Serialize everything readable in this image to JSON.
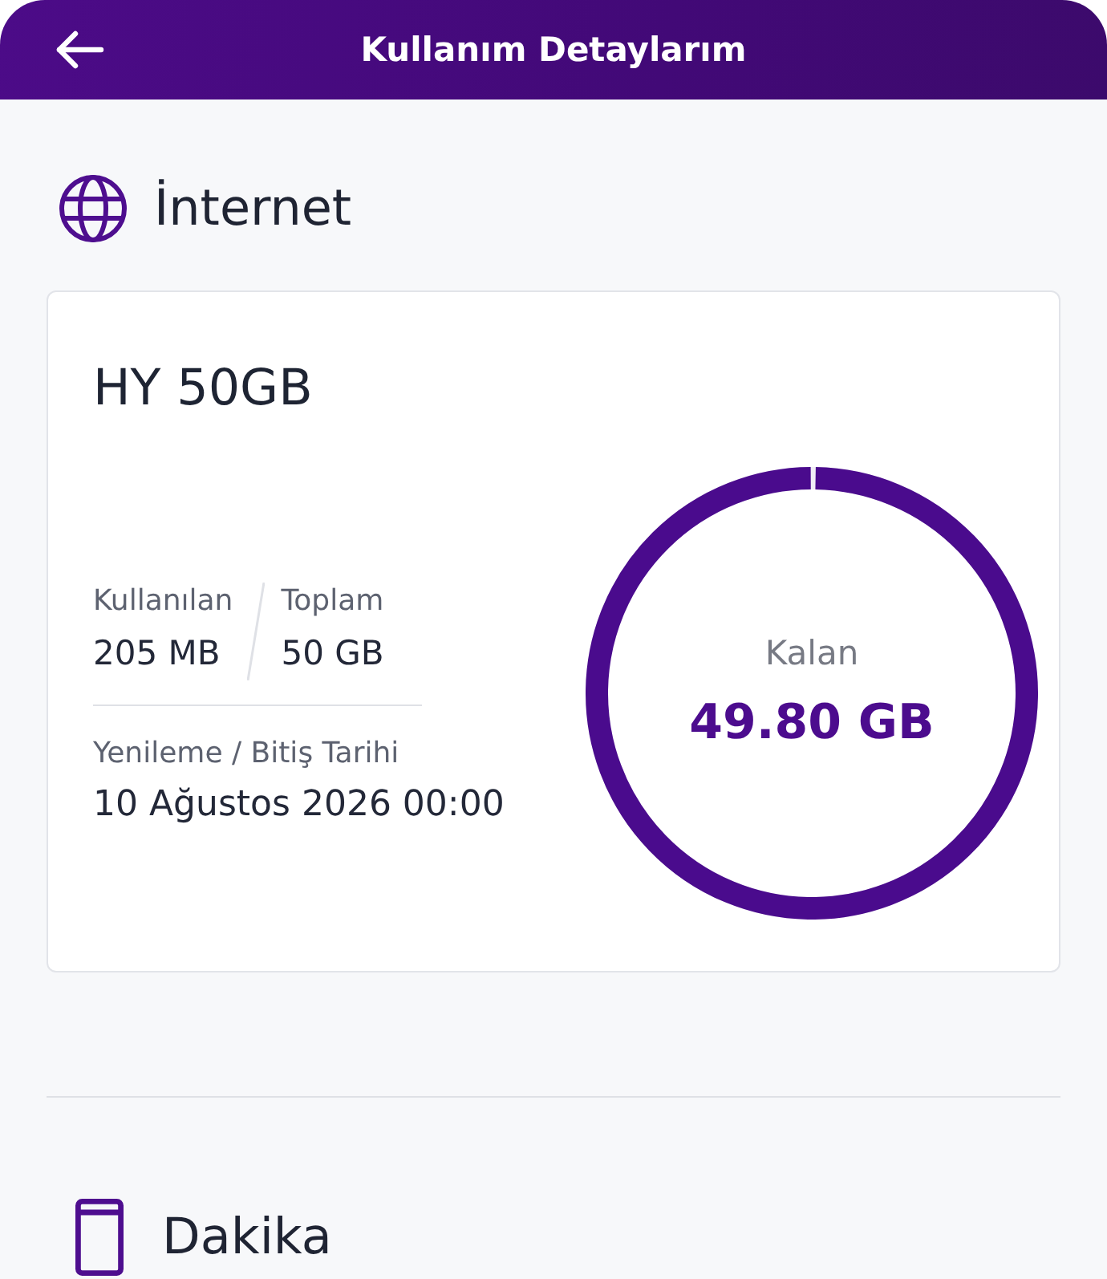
{
  "header": {
    "title": "Kullanım Detaylarım"
  },
  "sections": [
    {
      "kind": "internet",
      "title": "İnternet",
      "packages": [
        {
          "name": "HY 50GB",
          "used_label": "Kullanılan",
          "used": "205 MB",
          "total_label": "Toplam",
          "total": "50 GB",
          "renewal_label": "Yenileme / Bitiş Tarihi",
          "renewal": "10 Ağustos 2026 00:00",
          "remaining_label": "Kalan",
          "remaining": "49.80 GB",
          "level": 0.996
        }
      ]
    },
    {
      "kind": "minutes",
      "title": "Dakika"
    }
  ]
}
